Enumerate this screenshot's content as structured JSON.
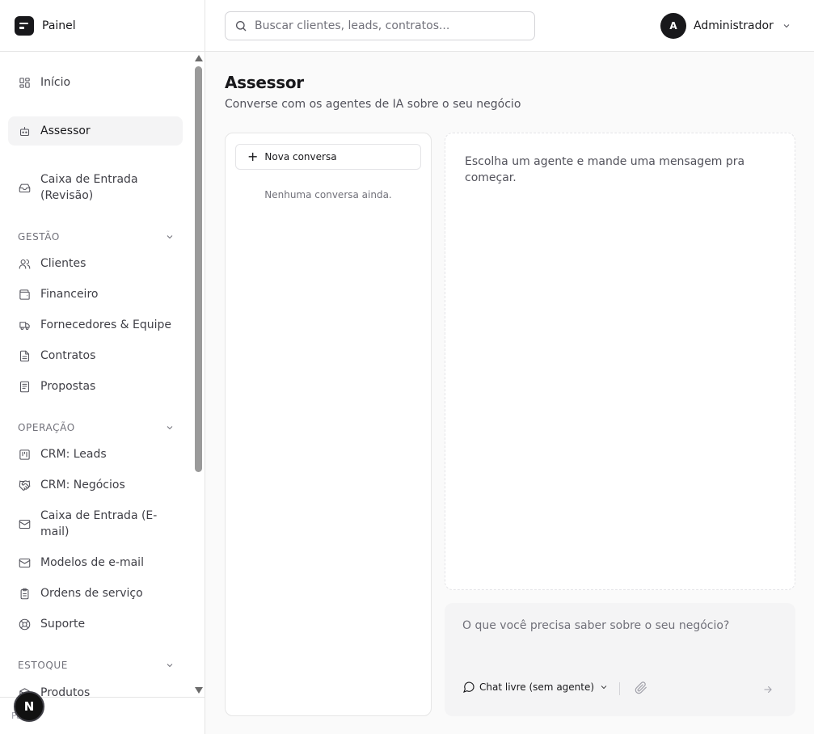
{
  "brand": {
    "name": "Painel"
  },
  "search": {
    "placeholder": "Buscar clientes, leads, contratos..."
  },
  "user": {
    "initial": "A",
    "name": "Administrador"
  },
  "sidebar": {
    "top_items": [
      {
        "label": "Início",
        "icon": "dashboard-icon"
      },
      {
        "label": "Assessor",
        "icon": "bot-icon",
        "active": true
      },
      {
        "label": "Caixa de Entrada (Revisão)",
        "icon": "inbox-icon"
      }
    ],
    "sections": [
      {
        "title": "GESTÃO",
        "items": [
          {
            "label": "Clientes",
            "icon": "users-icon"
          },
          {
            "label": "Financeiro",
            "icon": "wallet-icon"
          },
          {
            "label": "Fornecedores & Equipe",
            "icon": "truck-icon"
          },
          {
            "label": "Contratos",
            "icon": "file-text-icon"
          },
          {
            "label": "Propostas",
            "icon": "file-list-icon"
          }
        ]
      },
      {
        "title": "OPERAÇÃO",
        "items": [
          {
            "label": "CRM: Leads",
            "icon": "kanban-icon"
          },
          {
            "label": "CRM: Negócios",
            "icon": "handshake-icon"
          },
          {
            "label": "Caixa de Entrada (E-mail)",
            "icon": "mail-icon"
          },
          {
            "label": "Modelos de e-mail",
            "icon": "mail-template-icon"
          },
          {
            "label": "Ordens de serviço",
            "icon": "clipboard-icon"
          },
          {
            "label": "Suporte",
            "icon": "lifebuoy-icon"
          }
        ]
      },
      {
        "title": "ESTOQUE",
        "items": [
          {
            "label": "Produtos",
            "icon": "package-icon"
          }
        ]
      }
    ],
    "footer_label": "Painel",
    "dev_badge": "N"
  },
  "main": {
    "title": "Assessor",
    "subtitle": "Converse com os agentes de IA sobre o seu negócio",
    "new_conversation": "Nova conversa",
    "empty_conversations": "Nenhuma conversa ainda.",
    "chat_hint": "Escolha um agente e mande uma mensagem pra começar.",
    "composer_placeholder": "O que você precisa saber sobre o seu negócio?",
    "agent_selected": "Chat livre (sem agente)"
  }
}
